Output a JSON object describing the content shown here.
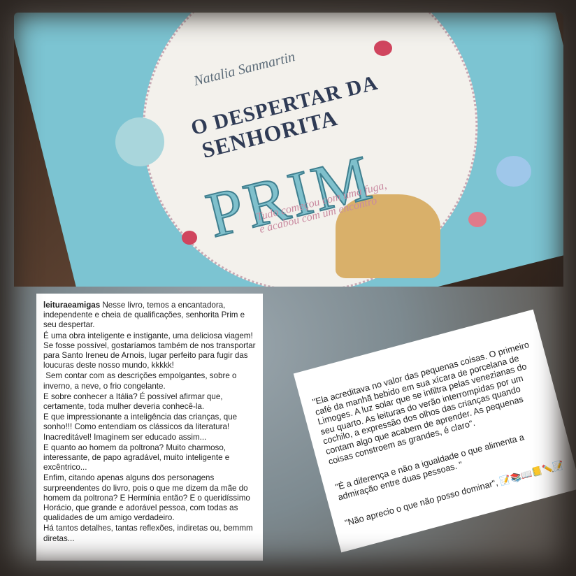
{
  "book_cover": {
    "author": "Natalia Sanmartin",
    "title_line1": "O DESPERTAR DA",
    "title_line2": "SENHORITA",
    "title_line3": "PRIM",
    "tagline": "Tudo começou com uma fuga, e acabou com um encontro"
  },
  "review": {
    "username": "leituraeamigas",
    "paragraphs": [
      "Nesse livro, temos a encantadora, independente e cheia de qualificações, senhorita Prim e seu despertar.",
      "É uma obra inteligente e instigante, uma deliciosa viagem! Se fosse possível, gostaríamos também de nos transportar para Santo Ireneu de Arnois, lugar perfeito para fugir das loucuras deste nosso mundo, kkkkk!",
      " Sem contar com as descrições empolgantes, sobre o inverno, a neve, o frio congelante.",
      "E sobre conhecer a Itália? É possível afirmar que, certamente, toda mulher deveria conhecê-la.",
      "E que impressionante a inteligência das crianças, que sonho!!! Como entendiam os clássicos da literatura! Inacreditável! Imaginem ser educado assim...",
      "E quanto ao homem da poltrona? Muito charmoso, interessante, de papo agradável, muito inteligente e excêntrico...",
      "Enfim, citando apenas alguns dos personagens surpreendentes do livro, pois o que me dizem da mãe do homem da poltrona? E Hermínia então? E o queridíssimo Horácio, que grande e adorável pessoa, com todas as qualidades de um amigo verdadeiro.",
      "Há tantos detalhes, tantas reflexões, indiretas ou, bemmm diretas..."
    ]
  },
  "quotes": [
    "\"Ela acreditava no valor das pequenas coisas. O primeiro café da manhã bebido em sua xícara de porcelana de Limoges. A luz solar que se infiltra pelas venezianas do seu quarto. As leituras do verão interrompidas por um cochilo, a expressão dos olhos das crianças quando contam algo que acabem de aprender. As pequenas coisas constroem as grandes, é claro\".",
    "\"É a diferença e não a igualdade o que alimenta a admiração entre duas pessoas. \"",
    "\"Não aprecio o que não posso dominar\", 📝📚📖📒✏️📝"
  ]
}
